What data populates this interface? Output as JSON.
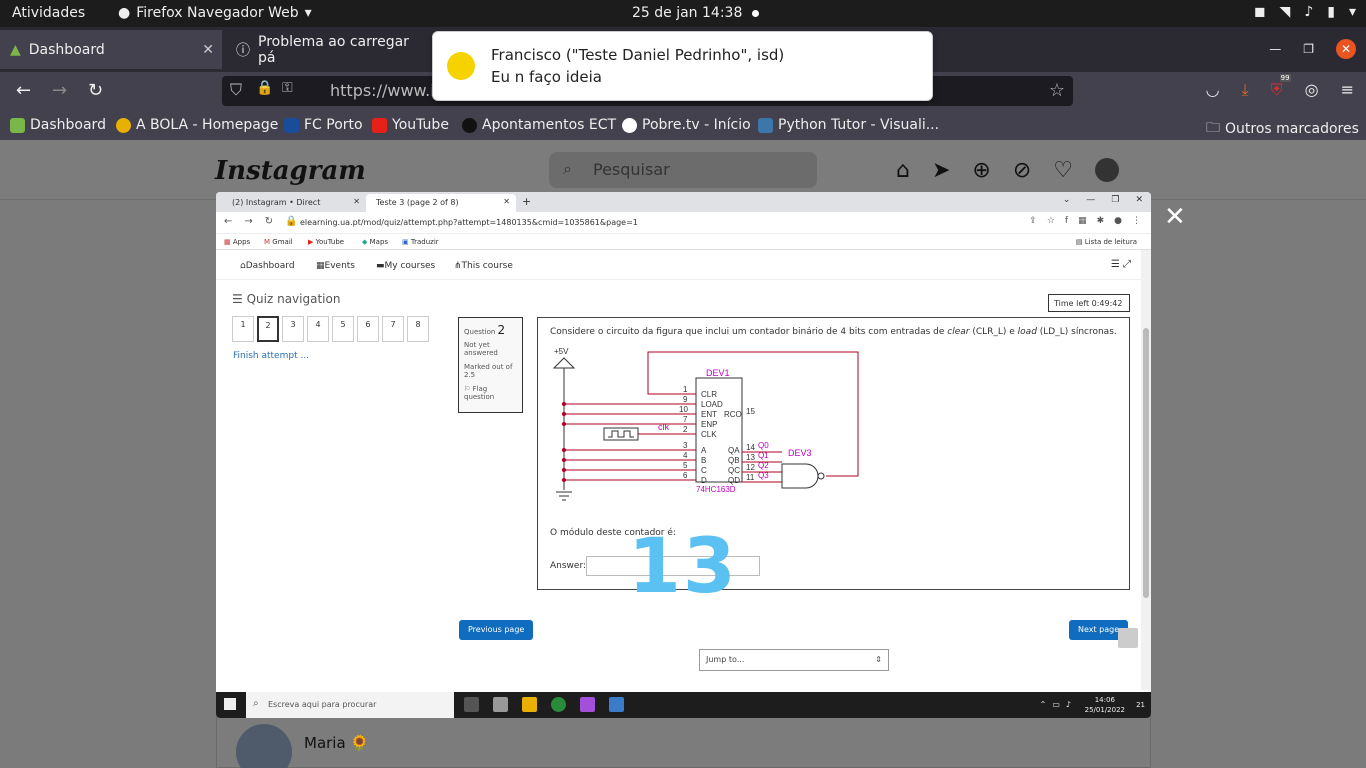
{
  "ubuntu": {
    "activities": "Atividades",
    "app": "Firefox Navegador Web",
    "clock": "25 de jan  14:38"
  },
  "firefox": {
    "tabs": [
      {
        "label": "Dashboard"
      },
      {
        "label": "Problema ao carregar pá"
      }
    ],
    "url": "https://www.in",
    "bookmarks": [
      "Dashboard",
      "A BOLA - Homepage",
      "FC Porto",
      "YouTube",
      "Apontamentos ECT",
      "Pobre.tv - Início",
      "Python Tutor - Visuali...",
      "Outros marcadores"
    ],
    "badge": "99"
  },
  "notification": {
    "title": "Francisco (\"Teste Daniel Pedrinho\", isd)",
    "body": "Eu n faço ideia"
  },
  "instagram": {
    "logo": "Instagram",
    "search_placeholder": "Pesquisar",
    "contact_name": "Maria 🌻"
  },
  "screenshot": {
    "chrome_tabs": [
      "(2) Instagram • Direct",
      "Teste 3 (page 2 of 8)"
    ],
    "url": "elearning.ua.pt/mod/quiz/attempt.php?attempt=1480135&cmid=1035861&page=1",
    "bookmarks": [
      "Apps",
      "Gmail",
      "YouTube",
      "Maps",
      "Traduzir",
      "Lista de leitura"
    ],
    "moodle_nav": [
      "Dashboard",
      "Events",
      "My courses",
      "This course"
    ],
    "quiz_nav_title": "Quiz navigation",
    "quiz_buttons": [
      "1",
      "2",
      "3",
      "4",
      "5",
      "6",
      "7",
      "8"
    ],
    "finish": "Finish attempt ...",
    "question_label": "Question",
    "question_number": "2",
    "question_status": "Not yet answered",
    "question_marks": "Marked out of 2.5",
    "flag": "Flag question",
    "time_left": "Time left 0:49:42",
    "question_text_a": "Considere o circuito da figura que inclui um contador binário de 4 bits com entradas de ",
    "question_clear": "clear",
    "question_text_b": " (CLR_L) e ",
    "question_load": "load",
    "question_text_c": " (LD_L) síncronas.",
    "circuit": {
      "supply": "+5V",
      "dev1": "DEV1",
      "dev3": "DEV3",
      "chip": "74HC163D",
      "clk": "clk",
      "pins_left": [
        "1",
        "9",
        "10",
        "7",
        "2",
        "3",
        "4",
        "5",
        "6"
      ],
      "labels_left": [
        "CLR",
        "LOAD",
        "ENT",
        "ENP",
        "CLK",
        "A",
        "B",
        "C",
        "D"
      ],
      "rco": "RCO",
      "rco_pin": "15",
      "outputs": [
        "QA",
        "QB",
        "QC",
        "QD"
      ],
      "out_pins": [
        "14",
        "13",
        "12",
        "11"
      ],
      "q_labels": [
        "Q0",
        "Q1",
        "Q2",
        "Q3"
      ]
    },
    "modulo_text": "O módulo deste contador é:",
    "answer_label": "Answer:",
    "handwritten": "13",
    "prev": "Previous page",
    "next": "Next page",
    "jump": "Jump to...",
    "taskbar_search": "Escreva aqui para procurar",
    "taskbar_time": "14:06",
    "taskbar_date": "25/01/2022",
    "taskbar_notif": "21"
  },
  "colors": {
    "ubuntu_bar": "#1c1c1c",
    "firefox_dark": "#2b2a33",
    "moodle_blue": "#0f6cbf",
    "circuit_red": "#b00020",
    "circuit_magenta": "#c000c0",
    "handwriting_blue": "#5bc0f2"
  }
}
